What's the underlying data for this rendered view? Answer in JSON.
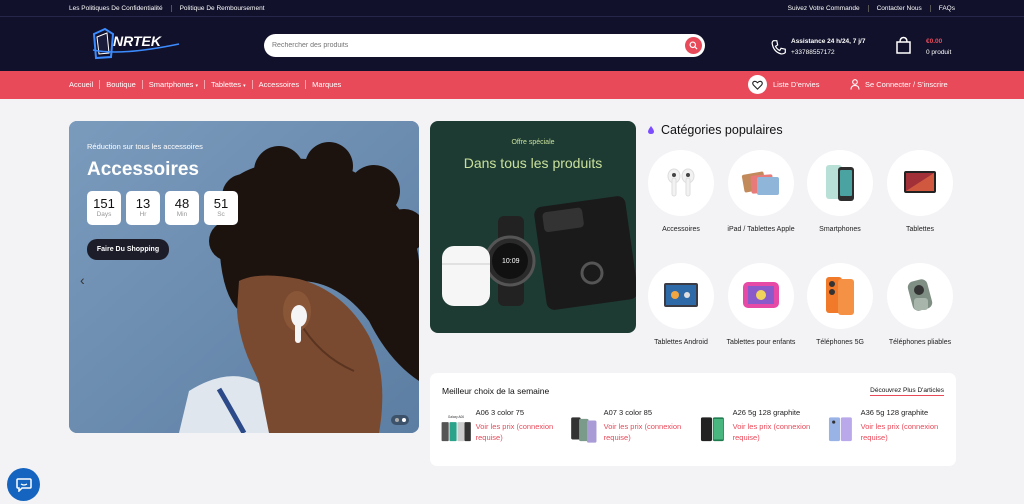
{
  "topbar": {
    "left_links": [
      "Les Politiques De Confidentialité",
      "Politique De Remboursement"
    ],
    "right_links": [
      "Suivez Votre Commande",
      "Contacter Nous",
      "FAQs"
    ]
  },
  "header": {
    "logo_text": "NRTEK",
    "search_placeholder": "Rechercher des produits",
    "assist_line1": "Assistance 24 h/24, 7 j/7",
    "assist_line2": "+33788557172",
    "cart_price": "€0.00",
    "cart_count": "0 produit"
  },
  "nav": {
    "items": [
      {
        "label": "Accueil",
        "dropdown": false
      },
      {
        "label": "Boutique",
        "dropdown": false
      },
      {
        "label": "Smartphones",
        "dropdown": true
      },
      {
        "label": "Tablettes",
        "dropdown": true
      },
      {
        "label": "Accessoires",
        "dropdown": false
      },
      {
        "label": "Marques",
        "dropdown": false
      }
    ],
    "wishlist": "Liste D'envies",
    "login": "Se Connecter / S'inscrire"
  },
  "hero": {
    "subtitle": "Réduction sur tous les accessoires",
    "title": "Accessoires",
    "timer": [
      {
        "value": "151",
        "unit": "Days"
      },
      {
        "value": "13",
        "unit": "Hr"
      },
      {
        "value": "48",
        "unit": "Min"
      },
      {
        "value": "51",
        "unit": "Sc"
      }
    ],
    "cta": "Faire Du Shopping"
  },
  "offer": {
    "subtitle": "Offre spéciale",
    "title": "Dans tous les produits",
    "watch_time": "10:09"
  },
  "categories": {
    "title": "Catégories populaires",
    "items": [
      {
        "label": "Accessoires"
      },
      {
        "label": "iPad / Tablettes Apple"
      },
      {
        "label": "Smartphones"
      },
      {
        "label": "Tablettes"
      },
      {
        "label": "Tablettes Android"
      },
      {
        "label": "Tablettes pour enfants"
      },
      {
        "label": "Téléphones 5G"
      },
      {
        "label": "Téléphones pliables"
      }
    ]
  },
  "best": {
    "title": "Meilleur choix de la semaine",
    "more": "Découvrez Plus D'articles",
    "products": [
      {
        "name": "A06 3 color 75",
        "price": "Voir les prix (connexion requise)",
        "tag": "Galaxy A06"
      },
      {
        "name": "A07 3 color 85",
        "price": "Voir les prix (connexion requise)"
      },
      {
        "name": "A26 5g 128 graphite",
        "price": "Voir les prix (connexion requise)"
      },
      {
        "name": "A36 5g 128 graphite",
        "price": "Voir les prix (connexion requise)"
      }
    ]
  },
  "colors": {
    "accent": "#e84a5a",
    "dark": "#11112b",
    "chat": "#1565c0"
  }
}
